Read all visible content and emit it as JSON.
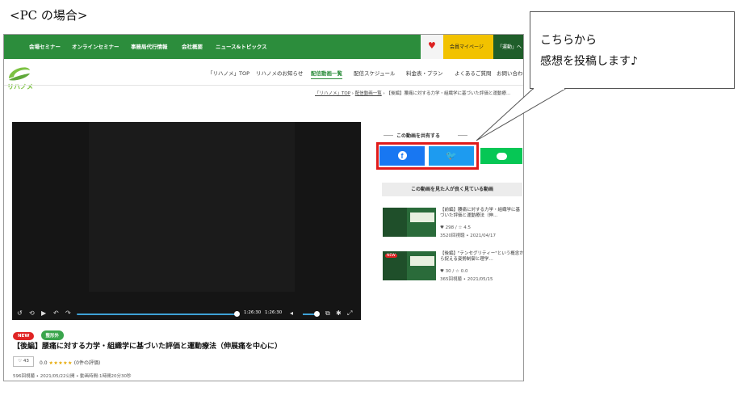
{
  "caption": "<PC の場合>",
  "topnav": {
    "items": [
      "会場セミナー",
      "オンラインセミナー",
      "事務局代行情報",
      "会社概要",
      "ニュース&トピックス"
    ],
    "heart_icon": "heart-icon",
    "mypage_label": "会員マイページ",
    "dark_label": "「運動」へ"
  },
  "logo": {
    "text": "リハノメ",
    "color": "#7cc242"
  },
  "subnav": {
    "items": [
      "「リハノメ」TOP",
      "リハノメのお知らせ",
      "配信動画一覧",
      "配信スケジュール",
      "料金表・プラン",
      "よくあるご質問",
      "お問い合わせ"
    ],
    "active_index": 2
  },
  "breadcrumb": {
    "home": "「リハノメ」TOP",
    "list": "配信動画一覧",
    "current": "【後編】腰痛に対する力学・組織学に基づいた評価と運動療…"
  },
  "video": {
    "elapsed": "1:26:30",
    "total": "1:26:30",
    "progress": 1.0,
    "title": "【後編】腰痛に対する力学・組織学に基づいた評価と運動療法（伸展痛を中心に）",
    "badges": [
      "NEW",
      "整形外"
    ],
    "likes": "43",
    "rating": "0.0",
    "stars": "★★★★★",
    "review_count": "(0件の評価)",
    "meta": "596回視聴 • 2021/05/22公開 • 動画時間:1時間20分30秒"
  },
  "share": {
    "label": "この動画を共有する",
    "facebook_icon": "facebook-icon",
    "twitter_icon": "twitter-icon",
    "line_icon": "line-icon",
    "colors": {
      "facebook": "#1877f2",
      "twitter": "#1d9bf0",
      "line": "#06c755",
      "highlight": "#e01a1a"
    }
  },
  "related": {
    "heading": "この動画を見た人が良く見ている動画",
    "items": [
      {
        "title": "【前編】腰痛に対する力学・組織学に基づいた評価と運動療法（伸…",
        "stats": "♥ 298 / ☆ 4.5",
        "date": "3520回視聴 • 2021/04/17",
        "tag": ""
      },
      {
        "title": "【後編】\"テンセグリティー\"という概念から捉える姿勢制御と理学…",
        "stats": "♥ 30 / ☆ 0.0",
        "date": "365回視聴 • 2021/05/15",
        "tag": "NEW"
      }
    ]
  },
  "callout": {
    "line1": "こちらから",
    "line2": "感想を投稿します♪"
  }
}
